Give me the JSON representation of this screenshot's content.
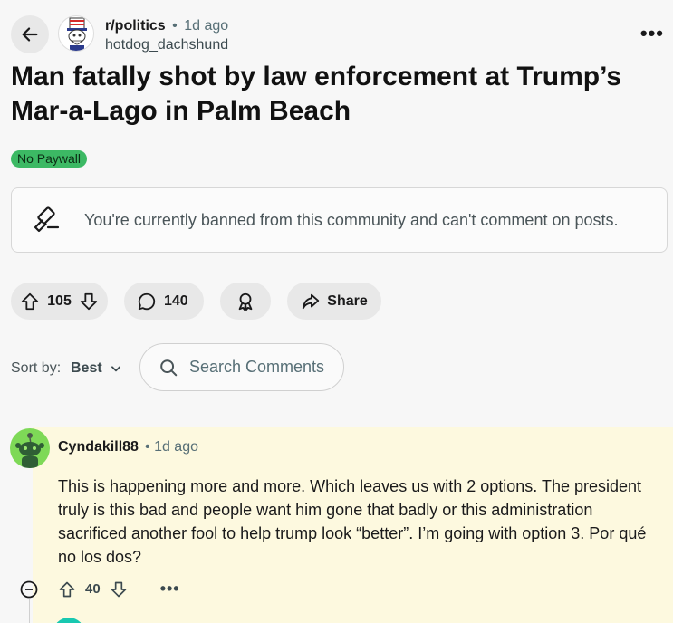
{
  "header": {
    "subreddit": "r/politics",
    "separator": "•",
    "time_ago": "1d ago",
    "author": "hotdog_dachshund",
    "more_label": "•••"
  },
  "post": {
    "title": "Man fatally shot by law enforcement at Trump’s Mar-a-Lago in Palm Beach",
    "flair": "No Paywall",
    "banned_message": "You're currently banned from this community and can't comment on posts."
  },
  "actions": {
    "upvotes": "105",
    "comments": "140",
    "share_label": "Share"
  },
  "sort": {
    "label": "Sort by:",
    "value": "Best"
  },
  "search": {
    "placeholder": "Search Comments"
  },
  "comment": {
    "author": "Cyndakill88",
    "separator": "•",
    "time_ago": "1d ago",
    "body": "This is happening more and more. Which leaves us with 2 options. The president truly is this bad and people want him gone that badly or this administration sacrificed another fool to help trump look “better”. I’m going with option 3. Por qué no los dos?",
    "votes": "40",
    "more_label": "•••"
  },
  "colors": {
    "flair_bg": "#3cb964",
    "comment_highlight": "#fdf9df",
    "comment_avatar": "#7ed957"
  }
}
